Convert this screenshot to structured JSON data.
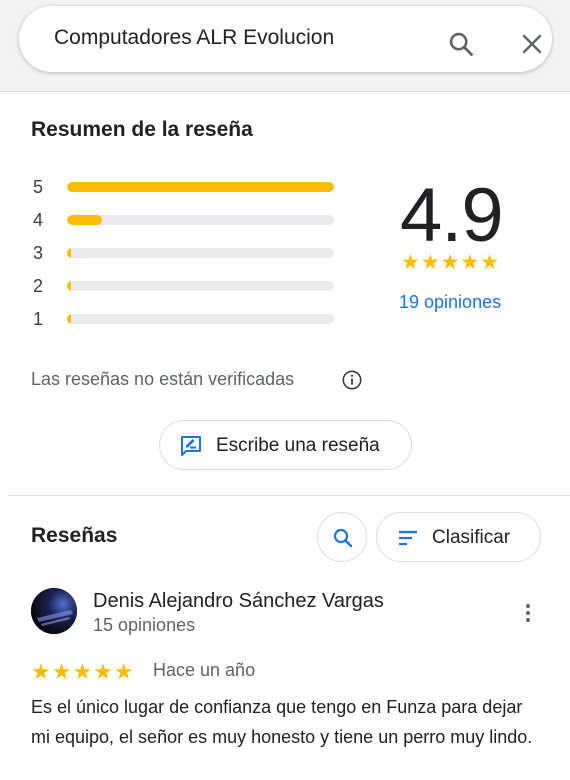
{
  "search": {
    "query": "Computadores ALR Evolucion",
    "search_icon": "search-icon",
    "close_icon": "close-icon"
  },
  "summary": {
    "title": "Resumen de la reseña",
    "distribution": [
      {
        "stars": "5",
        "fraction": 1.0
      },
      {
        "stars": "4",
        "fraction": 0.13
      },
      {
        "stars": "3",
        "fraction": 0.0
      },
      {
        "stars": "2",
        "fraction": 0.0
      },
      {
        "stars": "1",
        "fraction": 0.0
      }
    ],
    "average": "4.9",
    "star_rating": 5,
    "star_glyphs": "★★★★★",
    "opinions_label": "19 opiniones",
    "unverified_note": "Las reseñas no están verificadas",
    "info_icon": "info-icon",
    "write_review_label": "Escribe una reseña",
    "write_review_icon": "rate-review-icon"
  },
  "reviews": {
    "title": "Reseñas",
    "search_icon": "search-icon",
    "sort_icon": "sort-icon",
    "sort_label": "Clasificar",
    "items": [
      {
        "author": "Denis Alejandro Sánchez Vargas",
        "author_reviews": "15 opiniones",
        "rating": 5,
        "star_glyphs": "★★★★★",
        "time": "Hace un año",
        "text": "Es el único lugar de confianza que tengo en Funza para dejar mi equipo, el señor es muy honesto y tiene un perro muy lindo.",
        "more_icon": "more-vert-icon"
      }
    ]
  },
  "colors": {
    "star": "#fbbc04",
    "link": "#1a73e8",
    "bar_track": "#e8eaed"
  }
}
